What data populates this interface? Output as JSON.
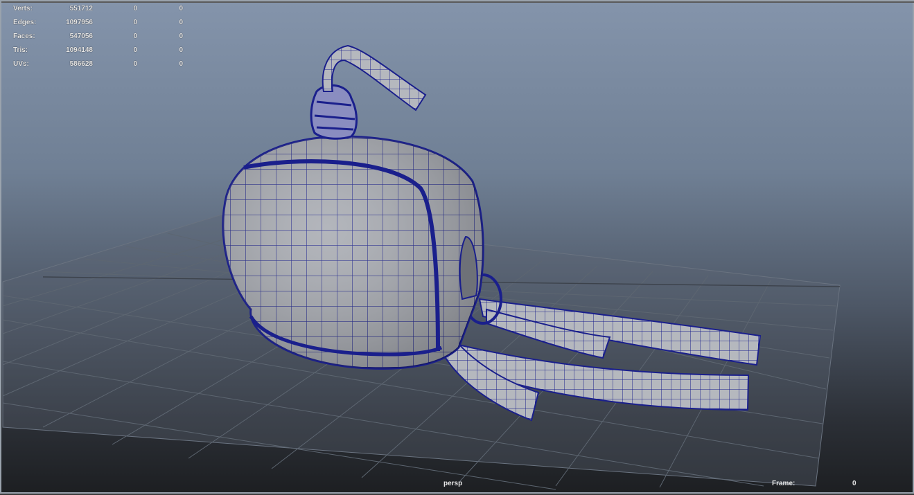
{
  "viewport": {
    "camera_label": "persp",
    "frame_label": "Frame:",
    "frame_value": "0"
  },
  "hud": {
    "rows": [
      {
        "label": "Verts:",
        "total": "551712",
        "selected": "0",
        "highlighted": "0"
      },
      {
        "label": "Edges:",
        "total": "1097956",
        "selected": "0",
        "highlighted": "0"
      },
      {
        "label": "Faces:",
        "total": "547056",
        "selected": "0",
        "highlighted": "0"
      },
      {
        "label": "Tris:",
        "total": "1094148",
        "selected": "0",
        "highlighted": "0"
      },
      {
        "label": "UVs:",
        "total": "586628",
        "selected": "0",
        "highlighted": "0"
      }
    ]
  },
  "colors": {
    "wireframe": "#1a1f8c",
    "mesh_fill": "#a9acb3",
    "grid": "#58606b"
  },
  "model": {
    "icon": "3d-hat-mesh-icon"
  }
}
